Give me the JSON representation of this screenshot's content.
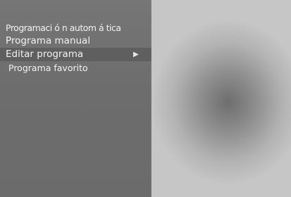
{
  "menu": {
    "items": [
      {
        "label": "Programaci ó n autom á tica"
      },
      {
        "label": "Programa manual"
      },
      {
        "label": "Editar programa",
        "selected": true,
        "has_submenu": true
      },
      {
        "label": "Programa favorito"
      }
    ]
  },
  "icons": {
    "submenu_arrow": "triangle-right-icon"
  },
  "colors": {
    "panel_bg": "#6d6d6d",
    "selected_bg": "#5f5f5f",
    "text": "#f2f2f2"
  }
}
